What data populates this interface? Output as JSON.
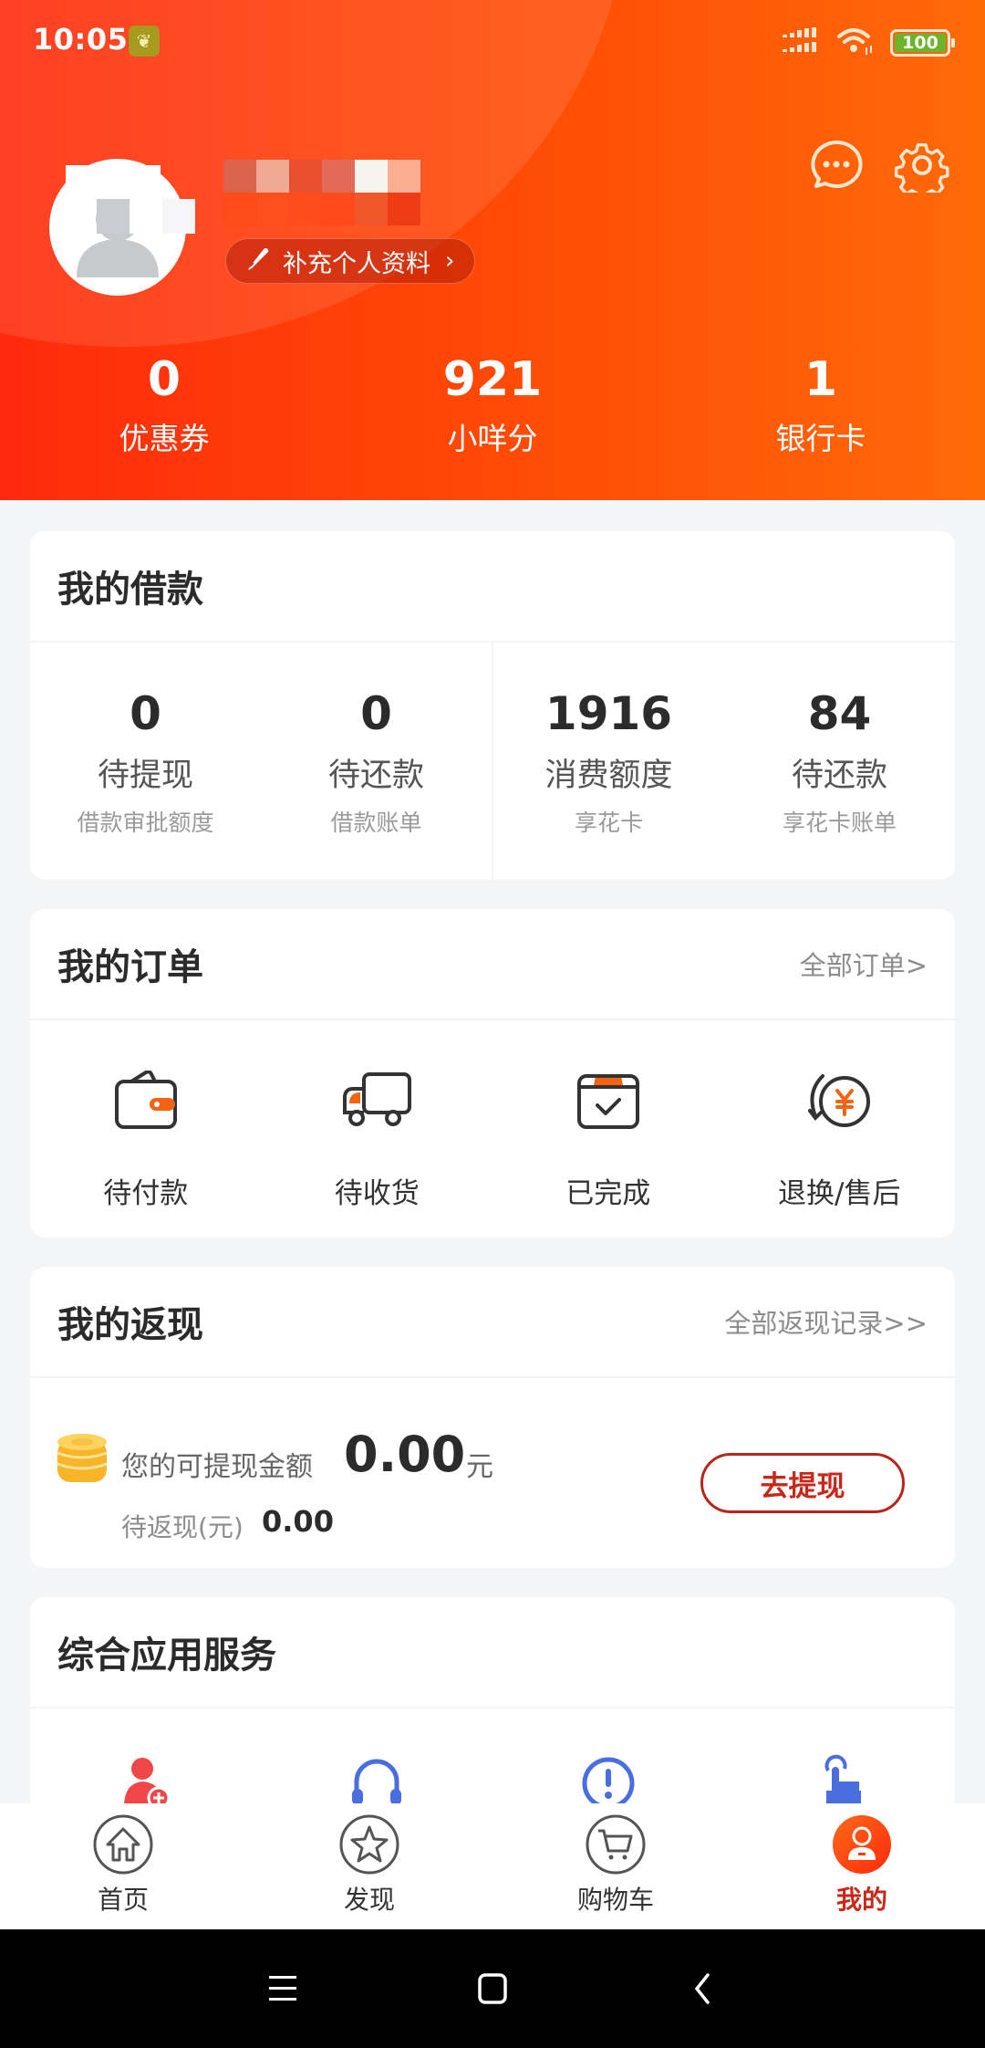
{
  "status_bar": {
    "time": "10:05",
    "app_icon": "feather-app-icon",
    "battery_level": "100",
    "icons": [
      "signal-icon",
      "wifi-icon",
      "battery-icon"
    ]
  },
  "profile": {
    "name": "(redacted)",
    "complete_profile_label": "补充个人资料",
    "complete_profile_icon": "pencil-icon",
    "message_icon": "chat-bubble-icon",
    "settings_icon": "gear-icon"
  },
  "stats": [
    {
      "value": "0",
      "label": "优惠券"
    },
    {
      "value": "921",
      "label": "小咩分"
    },
    {
      "value": "1",
      "label": "银行卡"
    }
  ],
  "loan": {
    "title": "我的借款",
    "items": [
      {
        "value": "0",
        "label": "待提现",
        "sub": "借款审批额度"
      },
      {
        "value": "0",
        "label": "待还款",
        "sub": "借款账单"
      },
      {
        "value": "1916",
        "label": "消费额度",
        "sub": "享花卡"
      },
      {
        "value": "84",
        "label": "待还款",
        "sub": "享花卡账单"
      }
    ]
  },
  "orders": {
    "title": "我的订单",
    "link": "全部订单>",
    "items": [
      {
        "label": "待付款",
        "icon": "wallet-icon"
      },
      {
        "label": "待收货",
        "icon": "truck-icon"
      },
      {
        "label": "已完成",
        "icon": "box-check-icon"
      },
      {
        "label": "退换/售后",
        "icon": "refund-yen-icon"
      }
    ]
  },
  "cashback": {
    "title": "我的返现",
    "link": "全部返现记录>>",
    "withdrawable_label": "您的可提现金额",
    "withdrawable_amount": "0.00",
    "unit": "元",
    "pending_label": "待返现(元)",
    "pending_amount": "0.00",
    "withdraw_button": "去提现"
  },
  "services": {
    "title": "综合应用服务",
    "items": [
      {
        "icon": "add-user-icon"
      },
      {
        "icon": "headset-icon"
      },
      {
        "icon": "alert-icon"
      },
      {
        "icon": "tap-hand-icon"
      }
    ]
  },
  "tabbar": {
    "items": [
      {
        "label": "首页",
        "icon": "home-icon",
        "active": false
      },
      {
        "label": "发现",
        "icon": "star-icon",
        "active": false
      },
      {
        "label": "购物车",
        "icon": "cart-icon",
        "active": false
      },
      {
        "label": "我的",
        "icon": "user-icon",
        "active": true
      }
    ]
  },
  "colors": {
    "brand_red": "#ff2a0c",
    "brand_orange": "#ff6a08",
    "accent_red_text": "#c8281a",
    "icon_orange": "#f06414",
    "service_blue": "#4a6ee0",
    "service_red": "#f04848"
  }
}
